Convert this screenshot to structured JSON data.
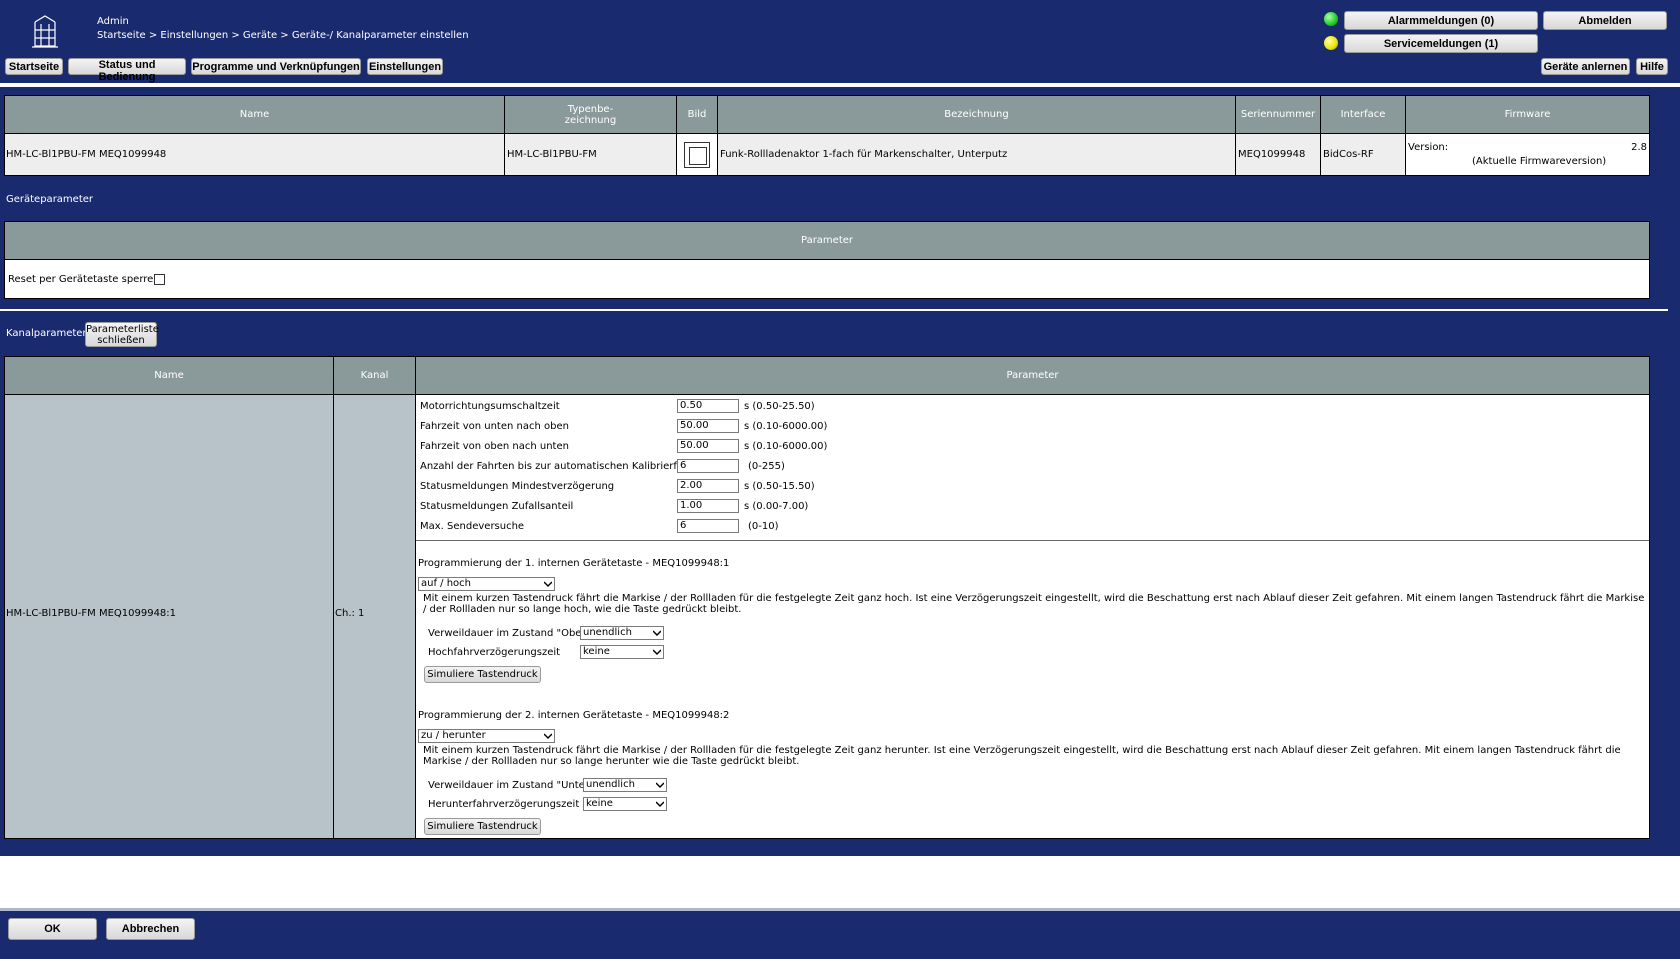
{
  "header": {
    "user": "Admin",
    "breadcrumb": "Startseite > Einstellungen > Geräte > Geräte-/ Kanalparameter einstellen",
    "nav": [
      "Startseite",
      "Status und Bedienung",
      "Programme und Verknüpfungen",
      "Einstellungen"
    ],
    "alarm_label": "Alarmmeldungen (0)",
    "service_label": "Servicemeldungen (1)",
    "logout_label": "Abmelden",
    "teach_label": "Geräte anlernen",
    "help_label": "Hilfe",
    "alarm_led_color": "#22cc22",
    "service_led_color": "#e6e600"
  },
  "device_table": {
    "headers": [
      "Name",
      "Typenbe-\nzeichnung",
      "Bild",
      "Bezeichnung",
      "Seriennummer",
      "Interface",
      "Firmware"
    ],
    "row": {
      "name": "HM-LC-Bl1PBU-FM MEQ1099948",
      "type": "HM-LC-Bl1PBU-FM",
      "description": "Funk-Rollladenaktor 1-fach für Markenschalter, Unterputz",
      "serial": "MEQ1099948",
      "interface": "BidCos-RF",
      "fw_label": "Version:",
      "fw_version": "2.8",
      "fw_note": "(Aktuelle Firmwareversion)"
    }
  },
  "device_params": {
    "title": "Geräteparameter",
    "header": "Parameter",
    "reset_label": "Reset per Gerätetaste sperren",
    "reset_checked": false
  },
  "channel_params": {
    "title": "Kanalparameter",
    "close_button": "Parameterliste schließen",
    "headers": [
      "Name",
      "Kanal",
      "Parameter"
    ],
    "name": "HM-LC-Bl1PBU-FM MEQ1099948:1",
    "channel": "Ch.: 1",
    "params": [
      {
        "label": "Motorrichtungsumschaltzeit",
        "value": "0.50",
        "unit": "s (0.50-25.50)"
      },
      {
        "label": "Fahrzeit von unten nach oben",
        "value": "50.00",
        "unit": "s (0.10-6000.00)"
      },
      {
        "label": "Fahrzeit von oben nach unten",
        "value": "50.00",
        "unit": "s (0.10-6000.00)"
      },
      {
        "label": "Anzahl der Fahrten bis zur automatischen Kalibrierfahrt",
        "value": "6",
        "unit": "(0-255)"
      },
      {
        "label": "Statusmeldungen Mindestverzögerung",
        "value": "2.00",
        "unit": "s (0.50-15.50)"
      },
      {
        "label": "Statusmeldungen Zufallsanteil",
        "value": "1.00",
        "unit": "s (0.00-7.00)"
      },
      {
        "label": "Max. Sendeversuche",
        "value": "6",
        "unit": "(0-10)"
      }
    ],
    "key1": {
      "title": "Programmierung der 1. internen Gerätetaste - MEQ1099948:1",
      "mode": "auf / hoch",
      "description": "Mit einem kurzen Tastendruck fährt die Markise / der Rollladen für die festgelegte Zeit ganz hoch. Ist eine Verzögerungszeit eingestellt, wird die Beschattung erst nach Ablauf dieser Zeit gefahren. Mit einem langen Tastendruck fährt die Markise / der Rollladen nur so lange hoch, wie die Taste gedrückt bleibt.",
      "dwell_label": "Verweildauer im Zustand \"Oben\"",
      "dwell_value": "unendlich",
      "delay_label": "Hochfahrverzögerungszeit",
      "delay_value": "keine",
      "simulate": "Simuliere Tastendruck"
    },
    "key2": {
      "title": "Programmierung der 2. internen Gerätetaste - MEQ1099948:2",
      "mode": "zu / herunter",
      "description": "Mit einem kurzen Tastendruck fährt die Markise / der Rollladen für die festgelegte Zeit ganz herunter. Ist eine Verzögerungszeit eingestellt, wird die Beschattung erst nach Ablauf dieser Zeit gefahren. Mit einem langen Tastendruck fährt die Markise / der Rollladen nur so lange herunter wie die Taste gedrückt bleibt.",
      "dwell_label": "Verweildauer im Zustand \"Unten\"",
      "dwell_value": "unendlich",
      "delay_label": "Herunterfahrverzögerungszeit",
      "delay_value": "keine",
      "simulate": "Simuliere Tastendruck"
    }
  },
  "footer": {
    "ok": "OK",
    "cancel": "Abbrechen"
  }
}
